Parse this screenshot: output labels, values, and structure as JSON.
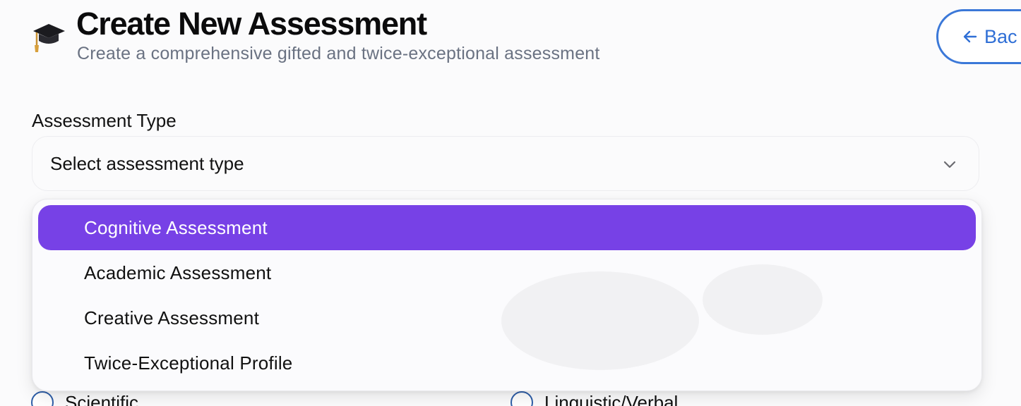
{
  "header": {
    "title": "Create New Assessment",
    "subtitle": "Create a comprehensive gifted and twice-exceptional assessment",
    "icon": "graduation-cap-icon",
    "back_label": "Bac"
  },
  "form": {
    "assessment_type": {
      "label": "Assessment Type",
      "placeholder": "Select assessment type",
      "options": [
        "Cognitive Assessment",
        "Academic Assessment",
        "Creative Assessment",
        "Twice-Exceptional Profile"
      ],
      "highlighted_index": 0
    },
    "areas_partial": [
      "Scientific",
      "Linguistic/Verbal"
    ]
  },
  "colors": {
    "accent_purple": "#7741e6",
    "back_blue": "#2f6fd6",
    "subtitle_gray": "#6a7282"
  }
}
